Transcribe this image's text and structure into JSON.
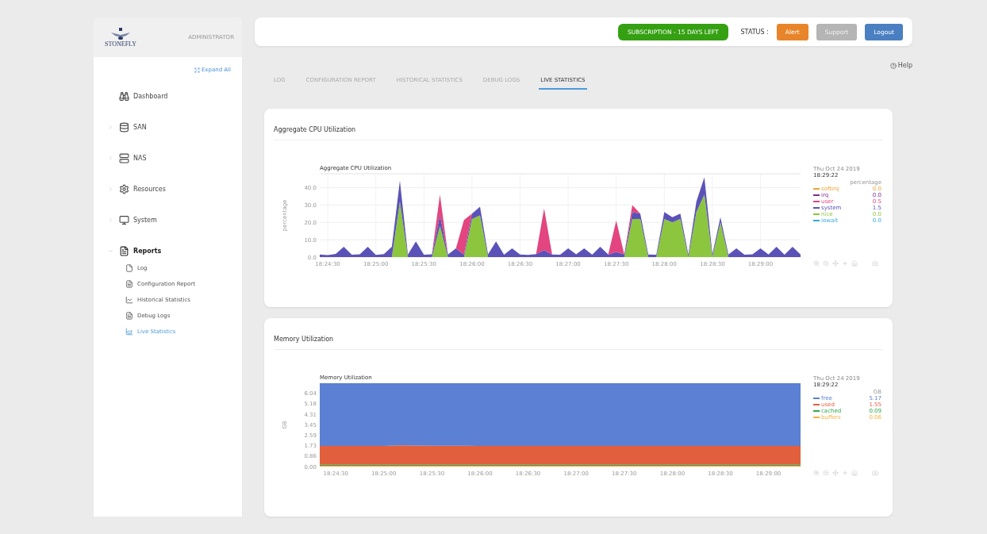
{
  "sidebar": {
    "logo_text": "STONEFLY",
    "role": "ADMINISTRATOR",
    "expand_all": "Expand All",
    "items": [
      {
        "label": "Dashboard",
        "selected": false
      },
      {
        "label": "SAN",
        "selected": false,
        "expanded": false
      },
      {
        "label": "NAS",
        "selected": false,
        "expanded": false
      },
      {
        "label": "Resources",
        "selected": false,
        "expanded": false
      },
      {
        "label": "System",
        "selected": false,
        "expanded": false
      },
      {
        "label": "Reports",
        "selected": true,
        "expanded": true,
        "children": [
          {
            "label": "Log",
            "selected": false
          },
          {
            "label": "Configuration Report",
            "selected": false
          },
          {
            "label": "Historical Statistics",
            "selected": false
          },
          {
            "label": "Debug Logs",
            "selected": false
          },
          {
            "label": "Live Statistics",
            "selected": true
          }
        ]
      }
    ]
  },
  "header": {
    "subscription": "SUBSCRIPTION - 15 DAYS LEFT",
    "status_label": "STATUS :",
    "buttons": [
      {
        "label": "Alert",
        "kind": "alert",
        "disabled": false
      },
      {
        "label": "Support",
        "kind": "support",
        "disabled": true
      },
      {
        "label": "Logout",
        "kind": "logout",
        "disabled": false
      }
    ]
  },
  "help": "Help",
  "tabs": [
    {
      "label": "LOG",
      "selected": false
    },
    {
      "label": "CONFIGURATION REPORT",
      "selected": false
    },
    {
      "label": "HISTORICAL STATISTICS",
      "selected": false
    },
    {
      "label": "DEBUG LOGS",
      "selected": false
    },
    {
      "label": "LIVE STATISTICS",
      "selected": true
    }
  ],
  "panels": [
    {
      "title": "Aggregate CPU Utilization",
      "legend_date": "Thu Oct 24 2019",
      "legend_time": "18:29:22",
      "legend_unit": "percentage",
      "legend": [
        {
          "name": "softirq",
          "value": "0.0",
          "color": "#e8a735"
        },
        {
          "name": "irq",
          "value": "0.0",
          "color": "#7d2f8f"
        },
        {
          "name": "user",
          "value": "0.5",
          "color": "#e2457f"
        },
        {
          "name": "system",
          "value": "1.5",
          "color": "#5b52b8"
        },
        {
          "name": "nice",
          "value": "0.0",
          "color": "#8cc63f"
        },
        {
          "name": "iowait",
          "value": "0.0",
          "color": "#37a9dc"
        }
      ],
      "chart_data": {
        "type": "area",
        "stacked": true,
        "grid": true,
        "title": "Aggregate CPU Utilization",
        "ylabel": "percentage",
        "categories": [
          null,
          "18:24:30",
          null,
          null,
          null,
          null,
          null,
          "18:25:00",
          null,
          null,
          null,
          null,
          null,
          "18:25:30",
          null,
          null,
          null,
          null,
          null,
          "18:26:00",
          null,
          null,
          null,
          null,
          null,
          "18:26:30",
          null,
          null,
          null,
          null,
          null,
          "18:27:00",
          null,
          null,
          null,
          null,
          null,
          "18:27:30",
          null,
          null,
          null,
          null,
          null,
          "18:28:00",
          null,
          null,
          null,
          null,
          null,
          "18:28:30",
          null,
          null,
          null,
          null,
          null,
          "18:29:00",
          null,
          null,
          null,
          null,
          null
        ],
        "ylim": [
          0,
          48
        ],
        "yticks": [
          {
            "value": 0,
            "label": "0.0"
          },
          {
            "value": 10,
            "label": "10.0"
          },
          {
            "value": 20,
            "label": "20.0"
          },
          {
            "value": 30,
            "label": "30.0"
          },
          {
            "value": 40,
            "label": "40.0"
          }
        ],
        "series": [
          {
            "color": "#8cc63f",
            "values": [
              0,
              0,
              0,
              0,
              0,
              0,
              0,
              0,
              0,
              0,
              32,
              0,
              0,
              0,
              0,
              18,
              0,
              0,
              0,
              22,
              24,
              0,
              0,
              0,
              0,
              0,
              0,
              0,
              0,
              0,
              0,
              0,
              0,
              0,
              0,
              0,
              0,
              0,
              0,
              22,
              22,
              0,
              0,
              22,
              20,
              22,
              0,
              26,
              36,
              0,
              20,
              0,
              0,
              0,
              0,
              0,
              0,
              0,
              0,
              0,
              0
            ]
          },
          {
            "color": "#5b52b8",
            "values": [
              1.5,
              1.2,
              1.8,
              6,
              1.4,
              1.6,
              6,
              1.3,
              1.7,
              6,
              12,
              1.5,
              9,
              1.4,
              1.6,
              6,
              1.5,
              5,
              1.4,
              3,
              5,
              1.6,
              9,
              1.4,
              5,
              1.5,
              1.3,
              1.7,
              4,
              1.5,
              1.4,
              5,
              1.6,
              5,
              1.4,
              6,
              1.5,
              3,
              1.6,
              4,
              3,
              1.5,
              1.4,
              4,
              3,
              3,
              1.5,
              6,
              10,
              1.6,
              3,
              1.5,
              5,
              1.4,
              1.6,
              5,
              1.5,
              6,
              1.4,
              6,
              1.5
            ]
          },
          {
            "color": "#e2457f",
            "values": [
              0,
              0,
              0,
              0,
              0,
              0,
              0,
              0,
              0,
              0,
              0,
              0,
              0,
              0,
              0,
              12,
              0,
              0,
              20,
              0,
              0,
              0,
              0,
              0,
              0,
              0,
              0,
              0,
              24,
              0,
              0,
              0,
              0,
              0,
              0,
              0,
              0,
              18,
              0,
              4,
              0,
              0,
              0,
              0,
              0,
              0,
              0,
              0,
              0,
              0,
              0,
              0,
              0,
              0,
              0,
              0,
              0,
              0,
              0,
              0,
              0
            ]
          }
        ]
      }
    },
    {
      "title": "Memory Utilization",
      "legend_date": "Thu Oct 24 2019",
      "legend_time": "18:29:22",
      "legend_unit": "GB",
      "legend": [
        {
          "name": "free",
          "value": "5.17",
          "color": "#5b80d4"
        },
        {
          "name": "used",
          "value": "1.55",
          "color": "#e25f3e"
        },
        {
          "name": "cached",
          "value": "0.09",
          "color": "#2fa84f"
        },
        {
          "name": "buffers",
          "value": "0.06",
          "color": "#f2b33d"
        }
      ],
      "chart_data": {
        "type": "area",
        "stacked": true,
        "grid": true,
        "title": "Memory Utilization",
        "ylabel": "GB",
        "categories": [
          null,
          "18:24:30",
          null,
          null,
          "18:25:00",
          null,
          null,
          "18:25:30",
          null,
          null,
          "18:26:00",
          null,
          null,
          "18:26:30",
          null,
          null,
          "18:27:00",
          null,
          null,
          "18:27:30",
          null,
          null,
          "18:28:00",
          null,
          null,
          "18:28:30",
          null,
          null,
          "18:29:00",
          null,
          null
        ],
        "ylim": [
          0,
          6.87
        ],
        "yticks": [
          {
            "value": 0,
            "label": "0.00"
          },
          {
            "value": 0.86,
            "label": "0.86"
          },
          {
            "value": 1.73,
            "label": "1.73"
          },
          {
            "value": 2.59,
            "label": "2.59"
          },
          {
            "value": 3.45,
            "label": "3.45"
          },
          {
            "value": 4.31,
            "label": "4.31"
          },
          {
            "value": 5.18,
            "label": "5.18"
          },
          {
            "value": 6.04,
            "label": "6.04"
          }
        ],
        "series": [
          {
            "color": "#f2b33d",
            "values": [
              0.06,
              0.06,
              0.06,
              0.06,
              0.06,
              0.06,
              0.06,
              0.06,
              0.06,
              0.06,
              0.06,
              0.06,
              0.06,
              0.06,
              0.06,
              0.06,
              0.06,
              0.06,
              0.06,
              0.06,
              0.06,
              0.06,
              0.06,
              0.06,
              0.06,
              0.06,
              0.06,
              0.06,
              0.06,
              0.06,
              0.06
            ]
          },
          {
            "color": "#2fa84f",
            "values": [
              0.09,
              0.09,
              0.09,
              0.09,
              0.09,
              0.09,
              0.09,
              0.09,
              0.09,
              0.09,
              0.09,
              0.09,
              0.09,
              0.09,
              0.09,
              0.09,
              0.09,
              0.09,
              0.09,
              0.09,
              0.09,
              0.09,
              0.09,
              0.09,
              0.09,
              0.09,
              0.09,
              0.09,
              0.09,
              0.09,
              0.09
            ]
          },
          {
            "color": "#e25f3e",
            "values": [
              1.55,
              1.55,
              1.55,
              1.55,
              1.55,
              1.6,
              1.58,
              1.57,
              1.56,
              1.57,
              1.55,
              1.55,
              1.55,
              1.55,
              1.55,
              1.55,
              1.55,
              1.55,
              1.55,
              1.55,
              1.55,
              1.55,
              1.55,
              1.55,
              1.55,
              1.55,
              1.55,
              1.55,
              1.55,
              1.55,
              1.55
            ]
          },
          {
            "color": "#5b80d4",
            "values": [
              5.17,
              5.17,
              5.17,
              5.17,
              5.17,
              5.12,
              5.14,
              5.15,
              5.16,
              5.15,
              5.17,
              5.17,
              5.17,
              5.17,
              5.17,
              5.17,
              5.17,
              5.17,
              5.17,
              5.17,
              5.17,
              5.17,
              5.17,
              5.17,
              5.17,
              5.17,
              5.17,
              5.17,
              5.17,
              5.17,
              5.17
            ]
          }
        ]
      }
    }
  ]
}
